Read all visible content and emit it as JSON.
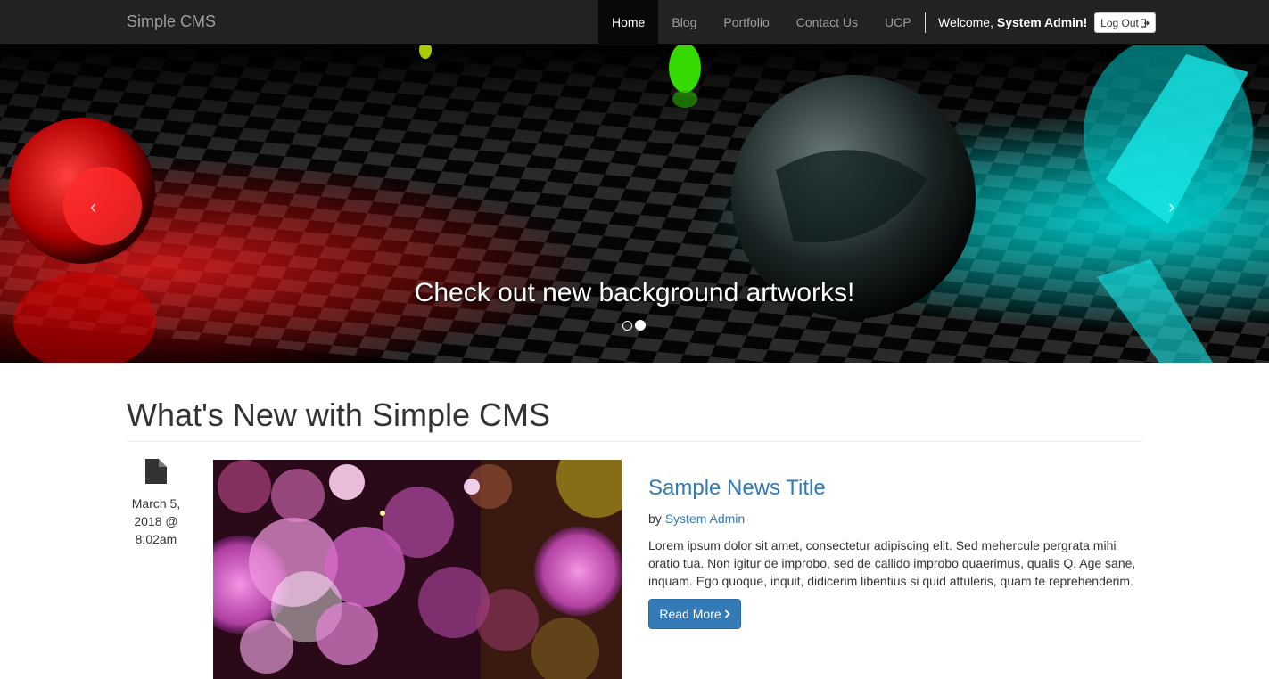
{
  "navbar": {
    "brand": "Simple CMS",
    "items": [
      {
        "label": "Home",
        "active": true
      },
      {
        "label": "Blog",
        "active": false
      },
      {
        "label": "Portfolio",
        "active": false
      },
      {
        "label": "Contact Us",
        "active": false
      },
      {
        "label": "UCP",
        "active": false
      }
    ],
    "welcome_prefix": "Welcome, ",
    "welcome_user": "System Admin",
    "welcome_suffix": "!",
    "logout_label": "Log Out",
    "logout_icon": "logout-icon"
  },
  "carousel": {
    "caption": "Check out new background artworks!",
    "prev_glyph": "‹",
    "next_glyph": "›",
    "slide_count": 2,
    "active_slide": 2
  },
  "main": {
    "heading": "What's New with Simple CMS",
    "posts": [
      {
        "icon": "file-icon",
        "date": "March 5, 2018 @ 8:02am",
        "title": "Sample News Title",
        "by_prefix": "by ",
        "author": "System Admin",
        "body": "Lorem ipsum dolor sit amet, consectetur adipiscing elit. Sed mehercule pergrata mihi oratio tua. Non igitur de improbo, sed de callido improbo quaerimus, qualis Q. Age sane, inquam. Ego quoque, inquit, didicerim libentius si quid attuleris, quam te reprehenderim.",
        "read_more_label": "Read More",
        "read_more_icon": "chevron-right-icon"
      }
    ]
  },
  "colors": {
    "navbar_bg": "#222222",
    "link": "#337ab7",
    "button_primary": "#337ab7"
  }
}
